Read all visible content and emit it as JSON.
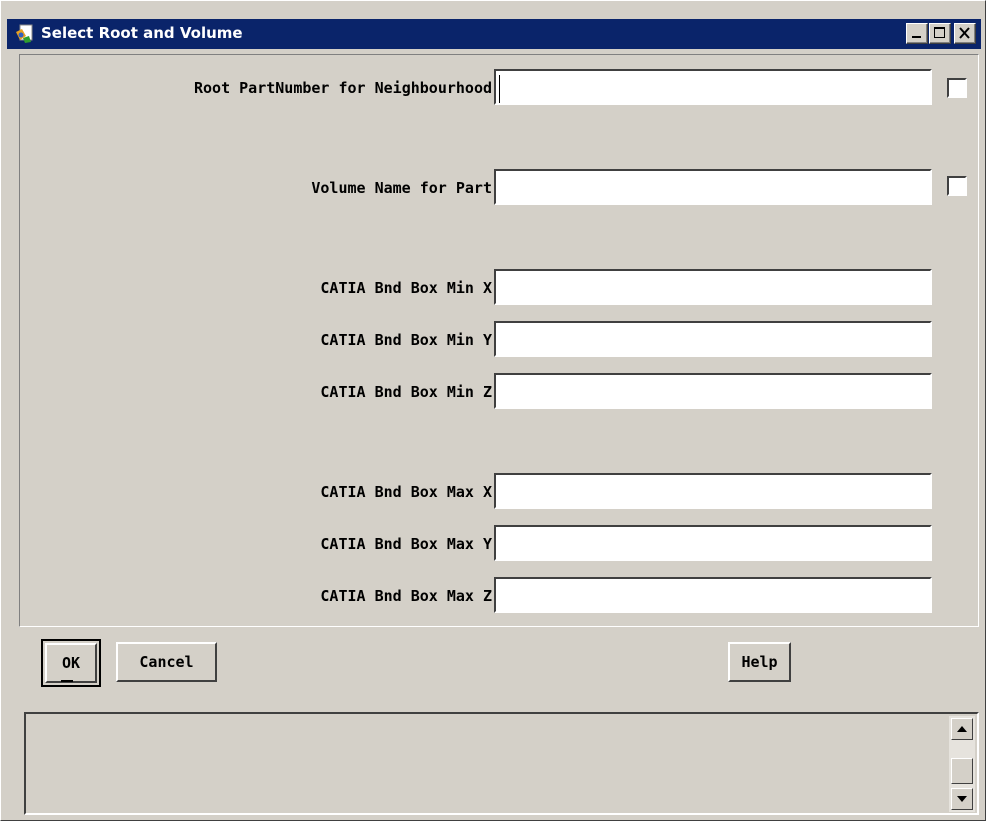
{
  "window": {
    "title": "Select Root and Volume",
    "icon": "catia-app-icon",
    "controls": [
      "minimize-icon",
      "maximize-icon",
      "close-icon"
    ]
  },
  "form": {
    "root_partnumber": {
      "label": "Root PartNumber for Neighbourhood",
      "value": "",
      "checked": false
    },
    "volume_name": {
      "label": "Volume Name for Part",
      "value": "",
      "checked": false
    },
    "min_x": {
      "label": "CATIA Bnd Box Min X",
      "value": ""
    },
    "min_y": {
      "label": "CATIA Bnd Box Min Y",
      "value": ""
    },
    "min_z": {
      "label": "CATIA Bnd Box Min Z",
      "value": ""
    },
    "max_x": {
      "label": "CATIA Bnd Box Max X",
      "value": ""
    },
    "max_y": {
      "label": "CATIA Bnd Box Max Y",
      "value": ""
    },
    "max_z": {
      "label": "CATIA Bnd Box Max Z",
      "value": ""
    }
  },
  "buttons": {
    "ok": "OK",
    "cancel": "Cancel",
    "help": "Help"
  },
  "message_area": {
    "text": ""
  }
}
